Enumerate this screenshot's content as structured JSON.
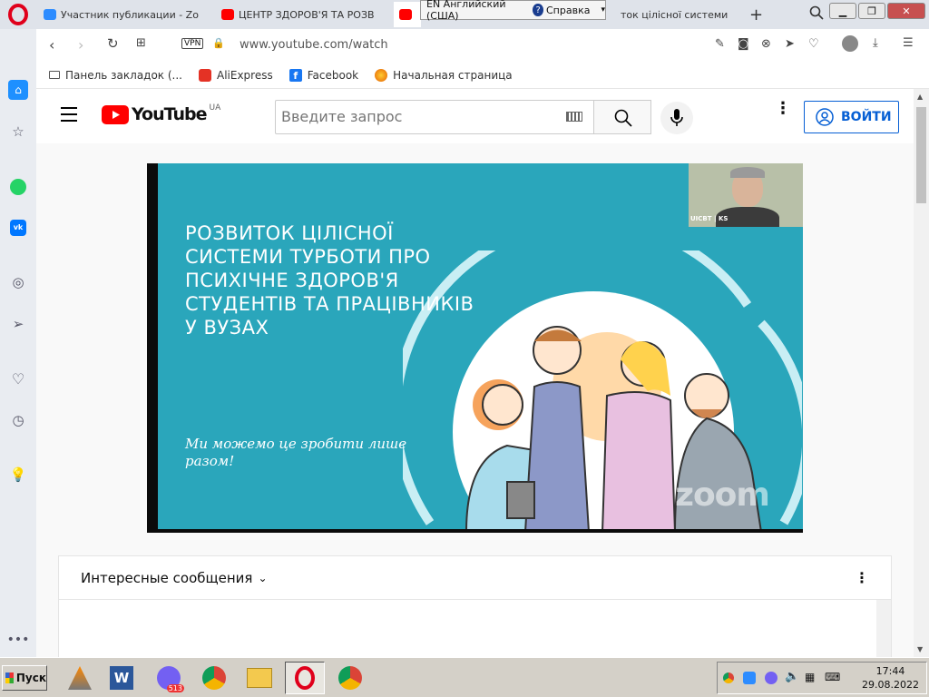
{
  "browser": {
    "tabs": [
      {
        "label": "Участник публикации - Zo",
        "favicon_color": "#2d8cff"
      },
      {
        "label": "ЦЕНТР ЗДОРОВ'Я ТА РОЗВ",
        "favicon_color": "#ff0000"
      },
      {
        "label": "",
        "favicon_color": "#ff0000"
      },
      {
        "label": "ток цілісної системи",
        "favicon_color": "#ff0000"
      }
    ],
    "language_bar": {
      "lang": "EN Английский (США)",
      "help": "Справка"
    },
    "url": "www.youtube.com/watch",
    "vpn_label": "VPN",
    "bookmarks": [
      {
        "label": "Панель закладок (..."
      },
      {
        "label": "AliExpress"
      },
      {
        "label": "Facebook"
      },
      {
        "label": "Начальная страница"
      }
    ]
  },
  "youtube": {
    "logo_text": "YouTube",
    "region": "UA",
    "search_placeholder": "Введите запрос",
    "signin_label": "ВОЙТИ",
    "video": {
      "slide_title": "Розвиток цілісної системи турботи про психічне здоров'я студентів та працівників у ВУЗах",
      "slogan": "Ми можемо це зробити лише разом!",
      "webcam_label": "UICBT | KS",
      "watermark": "zoom"
    },
    "chat": {
      "title": "Интересные сообщения"
    }
  },
  "taskbar": {
    "start_label": "Пуск",
    "viber_badge": "513",
    "time": "17:44",
    "date": "29.08.2022"
  }
}
